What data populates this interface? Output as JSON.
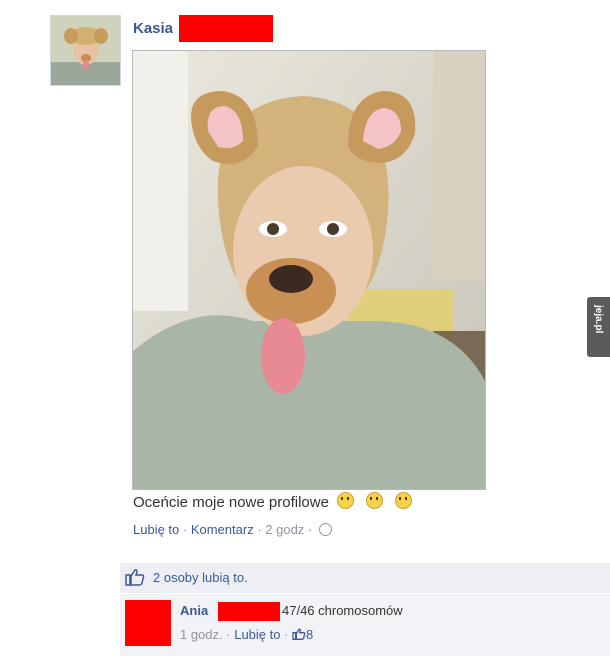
{
  "post": {
    "author_name": "Kasia",
    "caption": "Oceńcie moje nowe profilowe",
    "emojis": [
      "happy-face-icon",
      "neutral-face-icon",
      "tongue-face-icon"
    ],
    "actions": {
      "like": "Lubię to",
      "sep1": " · ",
      "comment": "Komentarz",
      "sep2": " · ",
      "time": "2 godz",
      "sep3": " · "
    }
  },
  "likes": {
    "text": "2 osoby lubią to."
  },
  "comment": {
    "author": "Ania",
    "text": "47/46 chromosomów",
    "time": "1 godz.",
    "sep1": " · ",
    "like": "Lubię to",
    "sep2": " · ",
    "like_count": "8"
  },
  "watermark": {
    "text": "jeja.pl"
  },
  "colors": {
    "link": "#3b5998",
    "redaction": "#ff0000",
    "likes_bg": "#edeff4"
  }
}
